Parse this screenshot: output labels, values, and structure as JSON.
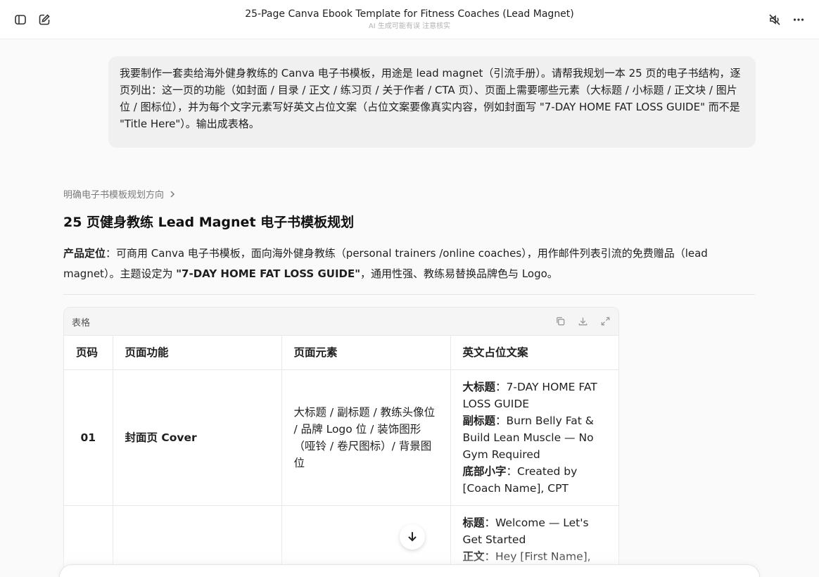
{
  "header": {
    "title": "25-Page Canva Ebook Template for Fitness Coaches (Lead Magnet)",
    "subtitle": "AI 生成可能有误 注意核实"
  },
  "user_message": "我要制作一套卖给海外健身教练的 Canva 电子书模板，用途是 lead magnet（引流手册）。请帮我规划一本 25 页的电子书结构，逐页列出：这一页的功能（如封面 / 目录 / 正文 / 练习页 / 关于作者 / CTA 页）、页面上需要哪些元素（大标题 / 小标题 / 正文块 / 图片位 / 图标位），并为每个文字元素写好英文占位文案（占位文案要像真实内容，例如封面写 \"7-DAY HOME FAT LOSS GUIDE\" 而不是 \"Title Here\"）。输出成表格。",
  "reasoning": {
    "label": "明确电子书模板规划方向"
  },
  "response": {
    "heading": "25 页健身教练 Lead Magnet 电子书模板规划",
    "para_label": "产品定位",
    "para_text1": "：可商用 Canva 电子书模板，面向海外健身教练（personal trainers /online coaches），用作邮件列表引流的免费赠品（lead magnet）。主题设定为 ",
    "para_bold": "\"7-DAY HOME FAT LOSS GUIDE\"",
    "para_text2": "，通用性强、教练易替换品牌色与 Logo。"
  },
  "table": {
    "label": "表格",
    "headers": [
      "页码",
      "页面功能",
      "页面元素",
      "英文占位文案"
    ],
    "rows": [
      {
        "num": "01",
        "func": "封面页 Cover",
        "elements": "大标题 / 副标题 / 教练头像位 / 品牌 Logo 位 / 装饰图形（哑铃 / 卷尺图标）/ 背景图位",
        "copy": [
          {
            "label": "大标题",
            "text": "：7-DAY HOME FAT LOSS GUIDE"
          },
          {
            "label": "副标题",
            "text": "：Burn Belly Fat & Build Lean Muscle — No Gym Required"
          },
          {
            "label": "底部小字",
            "text": "：Created by [Coach Name], CPT"
          }
        ]
      },
      {
        "num": "",
        "func": "",
        "elements": "",
        "copy": [
          {
            "label": "标题",
            "text": "：Welcome — Let's Get Started"
          },
          {
            "label": "正文",
            "text": "：Hey [First Name],"
          }
        ]
      }
    ]
  },
  "icons": {
    "sidebar": "sidebar-icon",
    "new_chat": "edit-icon",
    "mute": "speaker-mute-icon",
    "more": "more-icon",
    "copy": "copy-icon",
    "download": "download-icon",
    "expand": "expand-icon",
    "scroll": "arrow-down-icon"
  }
}
